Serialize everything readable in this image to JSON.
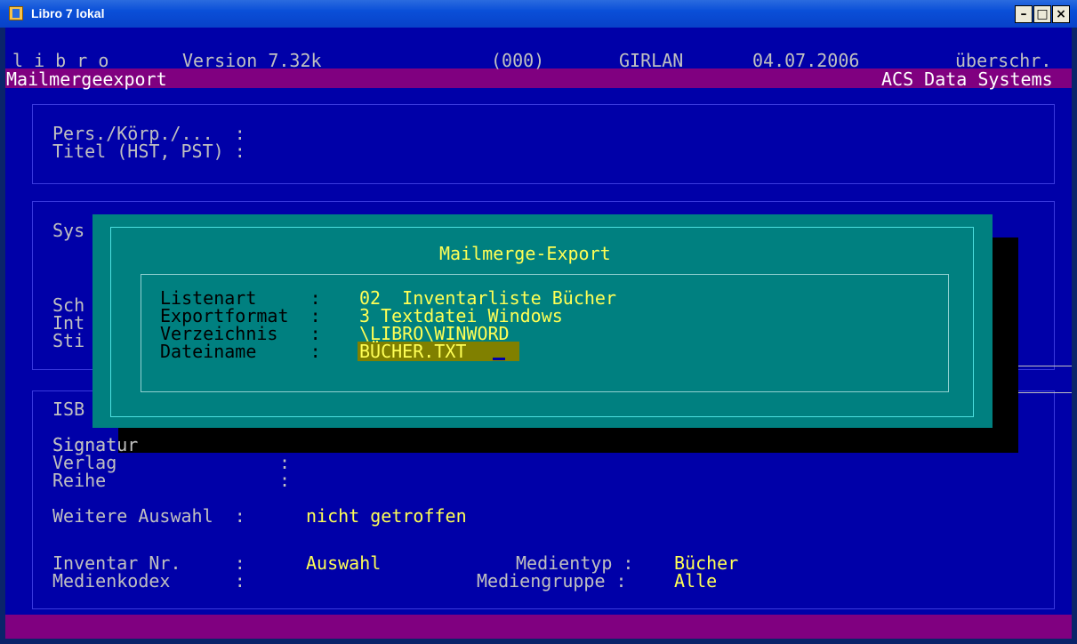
{
  "window": {
    "title": "Libro 7 lokal",
    "min_label": "–",
    "max_label": "□",
    "close_label": "×"
  },
  "header": {
    "app_name": "l i b r o",
    "version": "Version 7.32k",
    "code": "(000)",
    "location": "GIRLAN",
    "date": "04.07.2006",
    "mode": "überschr.",
    "module": "Mailmergeexport",
    "company": "ACS Data Systems"
  },
  "section1": {
    "pers_label": "Pers./Körp./...  :",
    "titel_label": "Titel (HST, PST) :"
  },
  "section2": {
    "sys_label": "Sys",
    "sch_label": "Sch",
    "int_label": "Int",
    "sti_label": "Sti"
  },
  "section3": {
    "isb_label": "ISB",
    "signatur_label": "Signatur",
    "signatur_sep": ":",
    "verlag_label": "Verlag",
    "verlag_sep": ":",
    "reihe_label": "Reihe",
    "reihe_sep": ":",
    "weitere_label": "Weitere Auswahl  :",
    "weitere_value": "nicht getroffen",
    "inventar_label": "Inventar Nr.     :",
    "inventar_value": "Auswahl",
    "medientyp_label": "Medientyp :",
    "medientyp_value": "Bücher",
    "medienkodex_label": "Medienkodex      :",
    "mediengruppe_label": "Mediengruppe :",
    "mediengruppe_value": "Alle"
  },
  "dialog": {
    "title": "Mailmerge-Export",
    "rows": [
      {
        "label": "Listenart     :",
        "value": "02  Inventarliste Bücher"
      },
      {
        "label": "Exportformat  :",
        "value": "3 Textdatei Windows"
      },
      {
        "label": "Verzeichnis   :",
        "value": "\\LIBRO\\WINWORD"
      },
      {
        "label": "Dateiname     :",
        "value": "BÜCHER.TXT"
      }
    ]
  },
  "colors": {
    "console_bg": "#0000A8",
    "header_bar": "#800080",
    "dialog_bg": "#008080",
    "value_text": "#FFFF55",
    "label_text": "#C0C0C0",
    "input_highlight": "#808000"
  }
}
